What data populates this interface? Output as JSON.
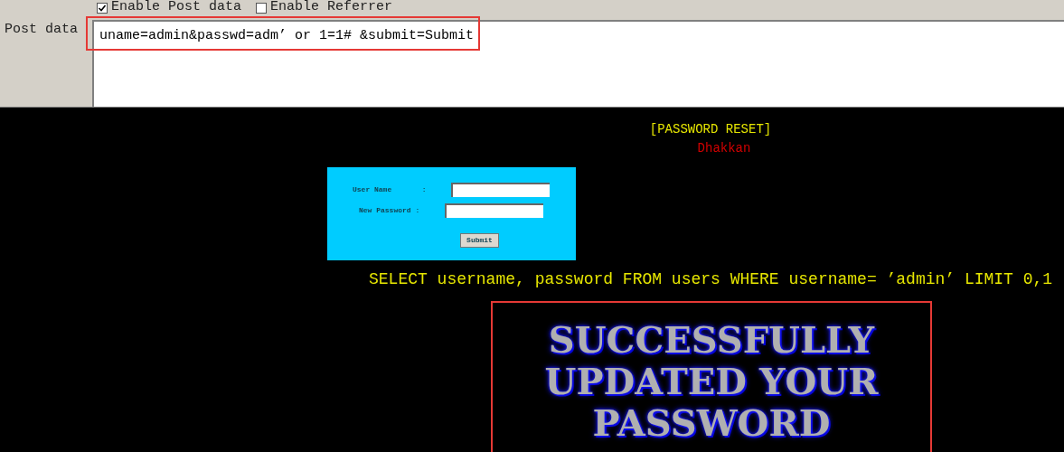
{
  "options": [
    {
      "label": "Enable Post data",
      "checked": true
    },
    {
      "label": "Enable Referrer",
      "checked": false
    }
  ],
  "post_data": {
    "label": "Post data",
    "value": "uname=admin&passwd=adm’ or 1=1# &submit=Submit"
  },
  "page": {
    "title": "[PASSWORD RESET]",
    "subtitle": "Dhakkan",
    "form": {
      "fields": [
        {
          "label": "User Name       :"
        },
        {
          "label": "New Password :"
        }
      ],
      "button": "Submit"
    },
    "query": "SELECT username, password FROM users WHERE username= ’admin’ LIMIT 0,1",
    "banner": [
      "SUCCESSFULLY",
      "UPDATED YOUR",
      "PASSWORD"
    ]
  }
}
